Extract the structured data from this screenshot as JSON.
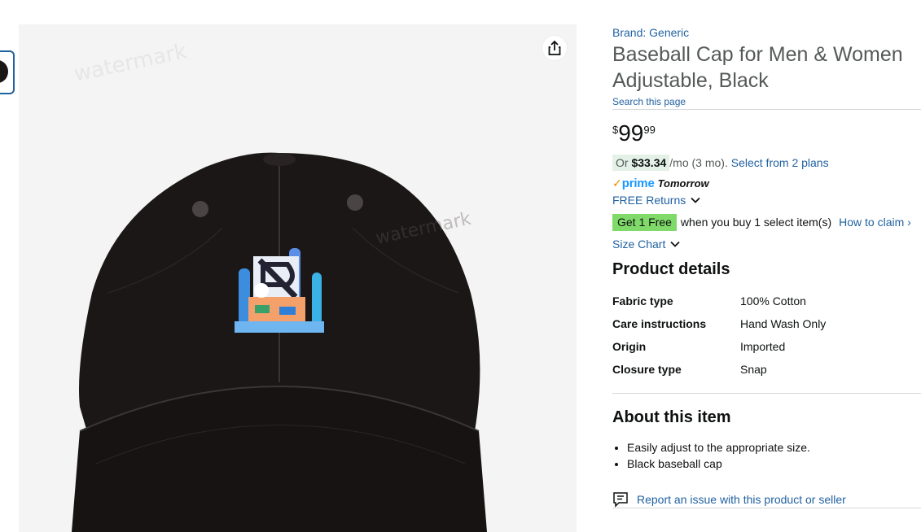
{
  "breadcrumb_partial": "",
  "product": {
    "brand_link": "Brand: Generic",
    "title": "Baseball Cap for Men & Women Adjustable, Black",
    "search_link": "Search this page"
  },
  "price": {
    "symbol": "$",
    "whole": "99",
    "fraction": "99"
  },
  "installment": {
    "prefix": "Or",
    "amount": "$33.34",
    "suffix": "/mo (3 mo).",
    "plans_link": "Select from 2 plans"
  },
  "prime": {
    "check": "✓",
    "word": "prime",
    "delivery": "Tomorrow"
  },
  "returns": {
    "label": "FREE Returns"
  },
  "promo": {
    "badge": "Get 1 Free",
    "text": "when you buy 1 select item(s)",
    "claim_link": "How to claim ›"
  },
  "size_chart": {
    "label": "Size Chart"
  },
  "product_details": {
    "heading": "Product details",
    "rows": [
      {
        "key": "Fabric type",
        "value": "100% Cotton"
      },
      {
        "key": "Care instructions",
        "value": "Hand Wash Only"
      },
      {
        "key": "Origin",
        "value": "Imported"
      },
      {
        "key": "Closure type",
        "value": "Snap"
      }
    ]
  },
  "about": {
    "heading": "About this item",
    "bullets": [
      "Easily adjust to the appropriate size.",
      "Black baseball cap"
    ]
  },
  "report": {
    "label": "Report an issue with this product or seller"
  },
  "colors": {
    "link": "#2162a1",
    "promo_badge": "#7fda69",
    "installment_bg": "#e3f1e7",
    "prime_blue": "#1a98ff",
    "prime_check": "#f08804",
    "cap": "#1c1717"
  },
  "icons": {
    "share": "share-icon",
    "returns_chevron": "chevron-down-icon",
    "size_chevron": "chevron-down-icon",
    "report": "report-flag-icon"
  }
}
